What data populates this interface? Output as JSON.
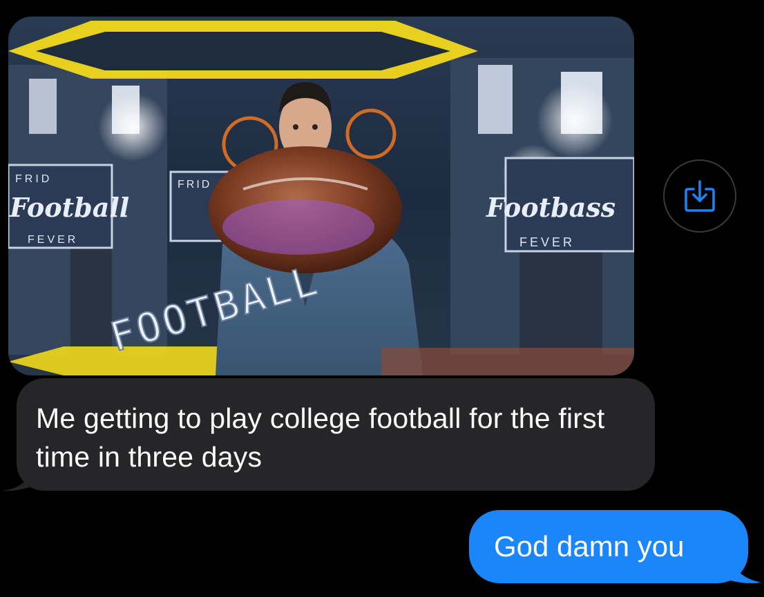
{
  "conversation": {
    "received": {
      "media": {
        "type": "video-still",
        "logo_text_left": "Football",
        "logo_text_right": "Footbass",
        "sign_friday": "FRID",
        "sign_fever": "FEVER",
        "overlay_caption": "FOOTBALL"
      },
      "text": "Me getting to play college football for the first time in three days"
    },
    "save_button": {
      "icon": "download-icon"
    },
    "sent": {
      "text": "God damn you"
    }
  },
  "colors": {
    "background": "#000000",
    "received_bubble": "#262628",
    "sent_bubble": "#1b86f9",
    "accent_icon": "#1b86f9",
    "button_border": "#3a3a3c"
  }
}
